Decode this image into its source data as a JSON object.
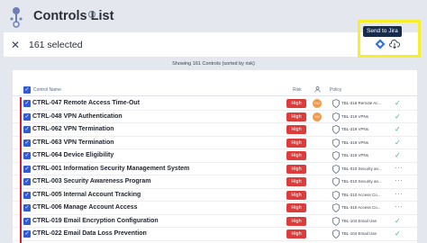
{
  "header": {
    "title": "Controls List",
    "info_symbol": "i"
  },
  "selection": {
    "count_label": "161 selected",
    "close_symbol": "✕"
  },
  "actions": {
    "tooltip": "Send to Jira"
  },
  "table": {
    "summary": "Showing 161 Controls (sorted by risk)",
    "columns": {
      "name": "Control Name",
      "risk": "Risk",
      "policy": "Policy"
    },
    "rows": [
      {
        "name": "CTRL-047 Remote Access Time-Out",
        "risk": "High",
        "avatar": "HU",
        "policy": "TBL-316 Remote Ac...",
        "status": "check"
      },
      {
        "name": "CTRL-048 VPN Authentication",
        "risk": "High",
        "avatar": "HU",
        "policy": "TBL-319 VPNs",
        "status": "check"
      },
      {
        "name": "CTRL-062 VPN Termination",
        "risk": "High",
        "avatar": "",
        "policy": "TBL-319 VPNs",
        "status": "check"
      },
      {
        "name": "CTRL-063 VPN Termination",
        "risk": "High",
        "avatar": "",
        "policy": "TBL-319 VPNs",
        "status": "check"
      },
      {
        "name": "CTRL-064 Device Eligibility",
        "risk": "High",
        "avatar": "",
        "policy": "TBL-319 VPNs",
        "status": "check"
      },
      {
        "name": "CTRL-001 Information Security Management System",
        "risk": "High",
        "avatar": "",
        "policy": "TBL-010 Security an...",
        "status": "more"
      },
      {
        "name": "CTRL-003 Security Awareness Program",
        "risk": "High",
        "avatar": "",
        "policy": "TBL-010 Security an...",
        "status": "more"
      },
      {
        "name": "CTRL-005 Internal Account Tracking",
        "risk": "High",
        "avatar": "",
        "policy": "TBL-310 Access Co...",
        "status": "more"
      },
      {
        "name": "CTRL-006 Manage Account Access",
        "risk": "High",
        "avatar": "",
        "policy": "TBL-310 Access Co...",
        "status": "more"
      },
      {
        "name": "CTRL-019 Email Encryption Configuration",
        "risk": "High",
        "avatar": "",
        "policy": "TBL-104 Email Use",
        "status": "check"
      },
      {
        "name": "CTRL-022 Email Data Loss Prevention",
        "risk": "High",
        "avatar": "",
        "policy": "TBL-104 Email Use",
        "status": "check"
      }
    ]
  },
  "symbols": {
    "check": "✓",
    "more": "···",
    "checkbox": "✓"
  },
  "colors": {
    "accent": "#2f5ad8",
    "risk_high": "#de3b3b",
    "highlight": "#f7ef2c",
    "success": "#36b37e"
  }
}
